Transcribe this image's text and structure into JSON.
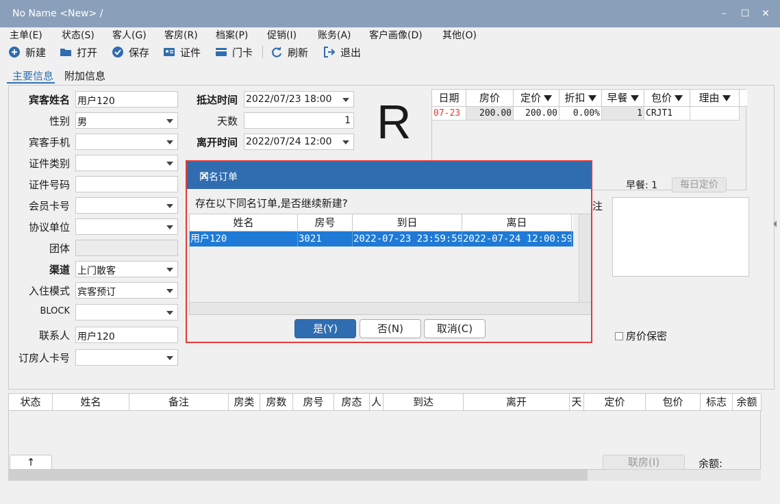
{
  "window": {
    "title": "No Name <New> /"
  },
  "menu": [
    "主单(E)",
    "状态(S)",
    "客人(G)",
    "客房(R)",
    "档案(P)",
    "促销(I)",
    "账务(A)",
    "客户画像(D)",
    "其他(O)"
  ],
  "toolbar": {
    "new": "新建",
    "open": "打开",
    "save": "保存",
    "id_card": "证件",
    "door_card": "门卡",
    "refresh": "刷新",
    "exit": "退出"
  },
  "tabs": {
    "main": "主要信息",
    "extra": "附加信息"
  },
  "form": {
    "guest_name_label": "宾客姓名",
    "guest_name": "用户120",
    "gender_label": "性别",
    "gender": "男",
    "mobile_label": "宾客手机",
    "mobile": "",
    "id_type_label": "证件类别",
    "id_type": "",
    "id_no_label": "证件号码",
    "id_no": "",
    "member_card_label": "会员卡号",
    "member_card": "",
    "agreement_label": "协议单位",
    "agreement": "",
    "group_label": "团体",
    "group": "",
    "channel_label": "渠道",
    "channel": "上门散客",
    "checkin_mode_label": "入住模式",
    "checkin_mode": "宾客预订",
    "block_label": "BLOCK",
    "block": "",
    "contact_label": "联系人",
    "contact": "用户120",
    "booker_card_label": "订房人卡号",
    "booker_card": "",
    "arrival_label": "抵达时间",
    "arrival": "2022/07/23 18:00",
    "days_label": "天数",
    "days": "1",
    "departure_label": "离开时间",
    "departure": "2022/07/24 12:00",
    "room_status_letter": "R"
  },
  "rate_grid": {
    "headers": [
      "日期",
      "房价",
      "定价",
      "折扣",
      "早餐",
      "包价",
      "理由"
    ],
    "rows": [
      {
        "date": "07-23",
        "price": "200.00",
        "list_price": "200.00",
        "discount": "0.00%",
        "breakfast": "1",
        "package": "CRJT1",
        "reason": ""
      }
    ],
    "colors": {
      "date_text": "#e53935"
    }
  },
  "breakfast_label": "早餐:",
  "breakfast_value": "1",
  "daily_rate_button": "每日定价",
  "memo_label": "注",
  "price_secret_label": "房价保密",
  "bottom_grid": {
    "headers": [
      "状态",
      "姓名",
      "备注",
      "房类",
      "房数",
      "房号",
      "房态",
      "人",
      "到达",
      "离开",
      "天",
      "定价",
      "包价",
      "标志",
      "余额"
    ]
  },
  "bottom": {
    "up_button": "↑",
    "link_room_button": "联房(I)",
    "balance_label": "余额:"
  },
  "dialog": {
    "title": "同名订单",
    "message": "存在以下同名订单,是否继续新建?",
    "headers": [
      "姓名",
      "房号",
      "到日",
      "离日"
    ],
    "rows": [
      {
        "name": "用户120",
        "room": "3021",
        "arrive": "2022-07-23 23:59:59",
        "depart": "2022-07-24 12:00:59"
      }
    ],
    "yes": "是(Y)",
    "no": "否(N)",
    "cancel": "取消(C)"
  },
  "colors": {
    "titlebar": "#8a9fb9",
    "accent": "#2f6db0",
    "selection": "#1e7ad6",
    "highlight_border": "#e53935"
  }
}
